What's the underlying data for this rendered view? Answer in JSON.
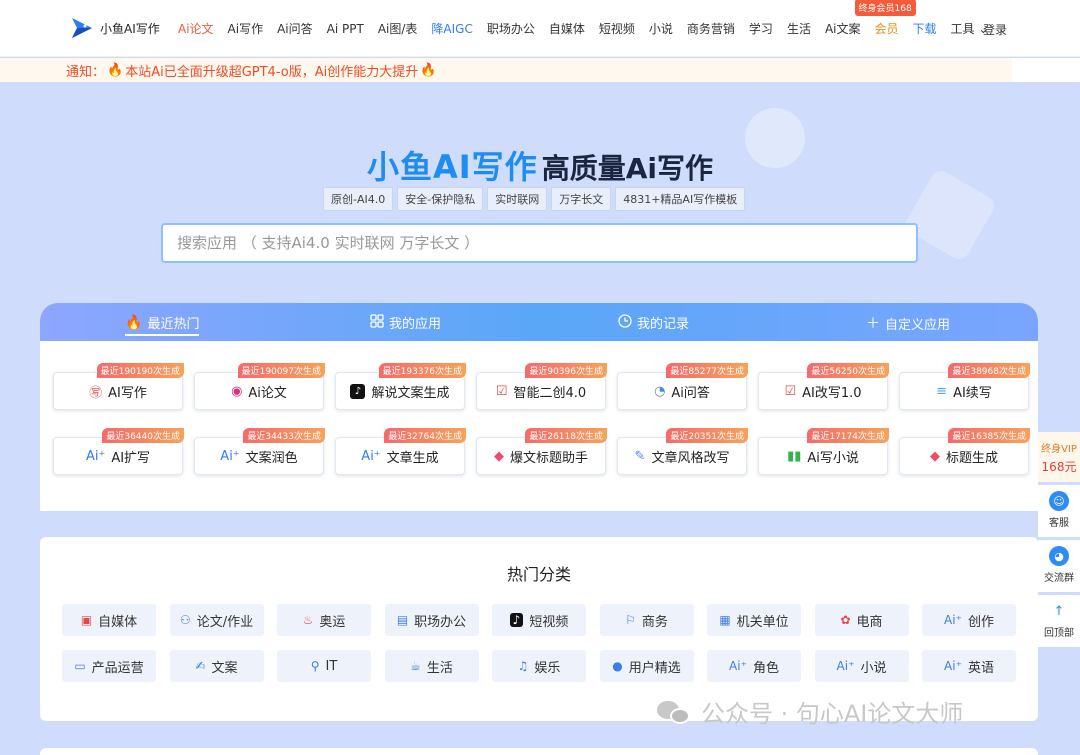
{
  "header": {
    "logo_text": "小鱼AI写作",
    "nav": [
      {
        "label": "Ai论文",
        "style": "active"
      },
      {
        "label": "Ai写作",
        "style": ""
      },
      {
        "label": "Ai问答",
        "style": ""
      },
      {
        "label": "Ai PPT",
        "style": ""
      },
      {
        "label": "Ai图/表",
        "style": ""
      },
      {
        "label": "降AIGC",
        "style": "blue"
      },
      {
        "label": "职场办公",
        "style": ""
      },
      {
        "label": "自媒体",
        "style": ""
      },
      {
        "label": "短视频",
        "style": ""
      },
      {
        "label": "小说",
        "style": ""
      },
      {
        "label": "商务营销",
        "style": ""
      },
      {
        "label": "学习",
        "style": ""
      },
      {
        "label": "生活",
        "style": ""
      },
      {
        "label": "Ai文案",
        "style": ""
      },
      {
        "label": "会员",
        "style": "orange"
      },
      {
        "label": "下载",
        "style": "blue"
      },
      {
        "label": "工具",
        "style": ""
      }
    ],
    "vip_badge": "终身会员168",
    "login": "登录"
  },
  "notice": {
    "label": "通知：",
    "text": "本站Ai已全面升级超GPT4-o版，Ai创作能力大提升"
  },
  "hero": {
    "brand": "小鱼AI写作",
    "tagline": "高质量Ai写作",
    "tags": [
      "原创-AI4.0",
      "安全-保护隐私",
      "实时联网",
      "万字长文",
      "4831+精品AI写作模板"
    ],
    "search_placeholder": "搜索应用 （ 支持Ai4.0 实时联网 万字长文 ）"
  },
  "tabs": [
    {
      "label": "最近热门",
      "icon": "fire-icon"
    },
    {
      "label": "我的应用",
      "icon": "grid-icon"
    },
    {
      "label": "我的记录",
      "icon": "clock-icon"
    },
    {
      "label": "自定义应用",
      "icon": "plus-icon"
    }
  ],
  "apps": [
    {
      "name": "AI写作",
      "count": "最近190190次生成",
      "icon": "write-icon",
      "color": "#e94b4b"
    },
    {
      "name": "Ai论文",
      "count": "最近190097次生成",
      "icon": "paper-icon",
      "color": "#d9327a"
    },
    {
      "name": "解说文案生成",
      "count": "最近193376次生成",
      "icon": "tiktok-icon",
      "color": "#111111"
    },
    {
      "name": "智能二创4.0",
      "count": "最近90396次生成",
      "icon": "rewrite-icon",
      "color": "#e94b4b"
    },
    {
      "name": "Ai问答",
      "count": "最近85277次生成",
      "icon": "chat-icon",
      "color": "#4f86f2"
    },
    {
      "name": "AI改写1.0",
      "count": "最近56250次生成",
      "icon": "rewrite-icon",
      "color": "#e94b4b"
    },
    {
      "name": "AI续写",
      "count": "最近38968次生成",
      "icon": "continue-icon",
      "color": "#4fa9e8"
    },
    {
      "name": "AI扩写",
      "count": "最近36440次生成",
      "icon": "ai-icon",
      "color": "#2f7df6"
    },
    {
      "name": "文案润色",
      "count": "最近34433次生成",
      "icon": "ai-icon",
      "color": "#2f7df6"
    },
    {
      "name": "文章生成",
      "count": "最近32764次生成",
      "icon": "ai-icon",
      "color": "#2f7df6"
    },
    {
      "name": "爆文标题助手",
      "count": "最近26118次生成",
      "icon": "tag-icon",
      "color": "#f04b6b"
    },
    {
      "name": "文章风格改写",
      "count": "最近20351次生成",
      "icon": "edit-icon",
      "color": "#4f86f2"
    },
    {
      "name": "Ai写小说",
      "count": "最近17174次生成",
      "icon": "book-icon",
      "color": "#35b24a"
    },
    {
      "name": "标题生成",
      "count": "最近16385次生成",
      "icon": "tag-icon",
      "color": "#f04b6b"
    }
  ],
  "categories": {
    "title": "热门分类",
    "items": [
      {
        "name": "自媒体",
        "icon": "media-icon"
      },
      {
        "name": "论文/作业",
        "icon": "student-icon"
      },
      {
        "name": "奥运",
        "icon": "torch-icon"
      },
      {
        "name": "职场办公",
        "icon": "briefcase-icon"
      },
      {
        "name": "短视频",
        "icon": "tiktok-icon"
      },
      {
        "name": "商务",
        "icon": "handshake-icon"
      },
      {
        "name": "机关单位",
        "icon": "building-icon"
      },
      {
        "name": "电商",
        "icon": "shop-icon"
      },
      {
        "name": "创作",
        "icon": "ai-icon"
      },
      {
        "name": "产品运营",
        "icon": "monitor-icon"
      },
      {
        "name": "文案",
        "icon": "pen-icon"
      },
      {
        "name": "IT",
        "icon": "engineer-icon"
      },
      {
        "name": "生活",
        "icon": "teapot-icon"
      },
      {
        "name": "娱乐",
        "icon": "music-icon"
      },
      {
        "name": "用户精选",
        "icon": "user-icon"
      },
      {
        "name": "角色",
        "icon": "ai-icon"
      },
      {
        "name": "小说",
        "icon": "ai-icon"
      },
      {
        "name": "英语",
        "icon": "ai-icon"
      }
    ]
  },
  "float_bar": {
    "vip_label": "终身VIP",
    "vip_price": "168元",
    "service": "客服",
    "group": "交流群",
    "top": "回顶部"
  },
  "watermark": "公众号 · 句心AI论文大师",
  "colors": {
    "accent": "#2f7df6",
    "notice": "#f04b25",
    "bg": "#cfdcfb"
  }
}
